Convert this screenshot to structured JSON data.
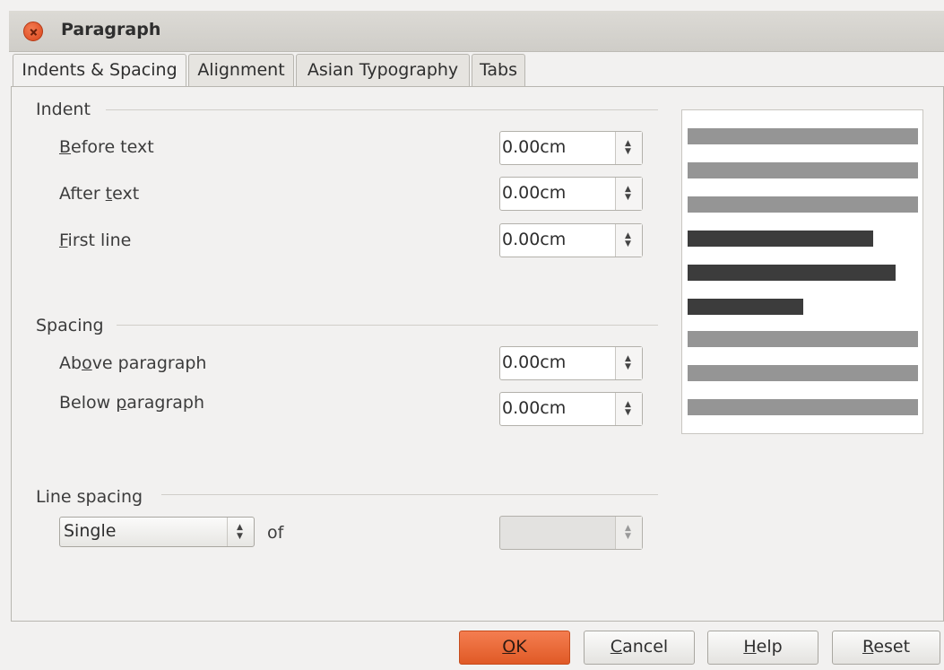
{
  "window": {
    "title": "Paragraph"
  },
  "tabs": [
    {
      "label": "Indents & Spacing",
      "active": true
    },
    {
      "label": "Alignment",
      "active": false
    },
    {
      "label": "Asian Typography",
      "active": false
    },
    {
      "label": "Tabs",
      "active": false
    }
  ],
  "indent": {
    "heading": "Indent",
    "before_text": {
      "pre": "",
      "mnemonic": "B",
      "post": "efore text",
      "value": "0.00cm"
    },
    "after_text": {
      "pre": "After ",
      "mnemonic": "t",
      "post": "ext",
      "value": "0.00cm"
    },
    "first_line": {
      "pre": "",
      "mnemonic": "F",
      "post": "irst line",
      "value": "0.00cm"
    }
  },
  "spacing": {
    "heading": "Spacing",
    "above": {
      "pre": "Ab",
      "mnemonic": "o",
      "post": "ve paragraph",
      "value": "0.00cm"
    },
    "below": {
      "pre": "Below ",
      "mnemonic": "p",
      "post": "aragraph",
      "value": "0.00cm"
    }
  },
  "line_spacing": {
    "heading": "Line spacing",
    "selected": "Single",
    "of_label": "of",
    "of_value": ""
  },
  "buttons": {
    "ok": {
      "mnemonic": "O",
      "post": "K"
    },
    "cancel": {
      "mnemonic": "C",
      "post": "ancel"
    },
    "help": {
      "mnemonic": "H",
      "post": "elp"
    },
    "reset": {
      "mnemonic": "R",
      "post": "eset"
    }
  },
  "icons": {
    "close": "close-icon",
    "spin_up": "chevron-up-icon",
    "spin_down": "chevron-down-icon"
  },
  "colors": {
    "accent": "#e05a26",
    "preview_light": "#959595",
    "preview_dark": "#3c3c3c"
  }
}
